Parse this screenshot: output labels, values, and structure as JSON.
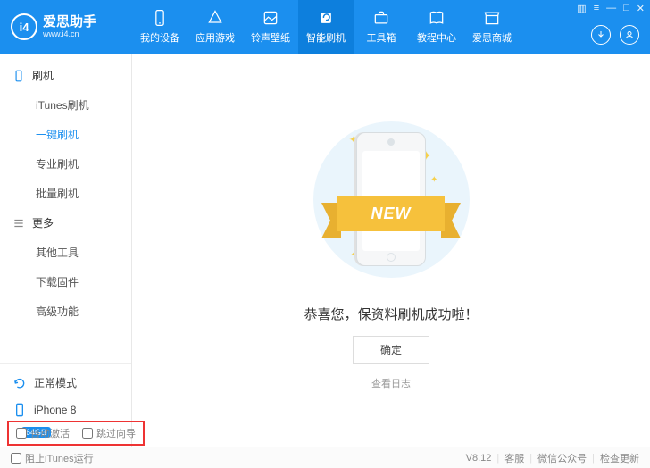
{
  "logo": {
    "mark": "i4",
    "title": "爱思助手",
    "sub": "www.i4.cn"
  },
  "nav": [
    {
      "label": "我的设备"
    },
    {
      "label": "应用游戏"
    },
    {
      "label": "铃声壁纸"
    },
    {
      "label": "智能刷机"
    },
    {
      "label": "工具箱"
    },
    {
      "label": "教程中心"
    },
    {
      "label": "爱思商城"
    }
  ],
  "sidebar": {
    "group1": {
      "title": "刷机",
      "items": [
        "iTunes刷机",
        "一键刷机",
        "专业刷机",
        "批量刷机"
      ]
    },
    "group2": {
      "title": "更多",
      "items": [
        "其他工具",
        "下载固件",
        "高级功能"
      ]
    },
    "mode": "正常模式",
    "device": "iPhone 8",
    "storage": "64GB"
  },
  "main": {
    "ribbon": "NEW",
    "success": "恭喜您，保资料刷机成功啦！",
    "ok": "确定",
    "log": "查看日志"
  },
  "footer_checks": {
    "auto_activate": "自动激活",
    "skip_setup": "跳过向导"
  },
  "statusbar": {
    "block_itunes": "阻止iTunes运行",
    "version": "V8.12",
    "support": "客服",
    "wechat": "微信公众号",
    "update": "检查更新"
  }
}
